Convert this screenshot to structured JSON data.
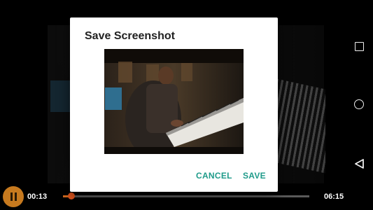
{
  "dialog": {
    "title": "Save Screenshot",
    "cancel_label": "CANCEL",
    "save_label": "SAVE"
  },
  "player": {
    "current_time": "00:13",
    "total_time": "06:15",
    "progress_fraction": 0.035,
    "state": "playing",
    "play_button_icon": "pause-icon",
    "accent_color": "#c77a1f"
  },
  "navbar": {
    "icons": [
      "recents-square-icon",
      "home-circle-icon",
      "back-triangle-icon"
    ]
  },
  "colors": {
    "dialog_button": "#1f9b8a",
    "seek_fill": "#d2691e"
  }
}
